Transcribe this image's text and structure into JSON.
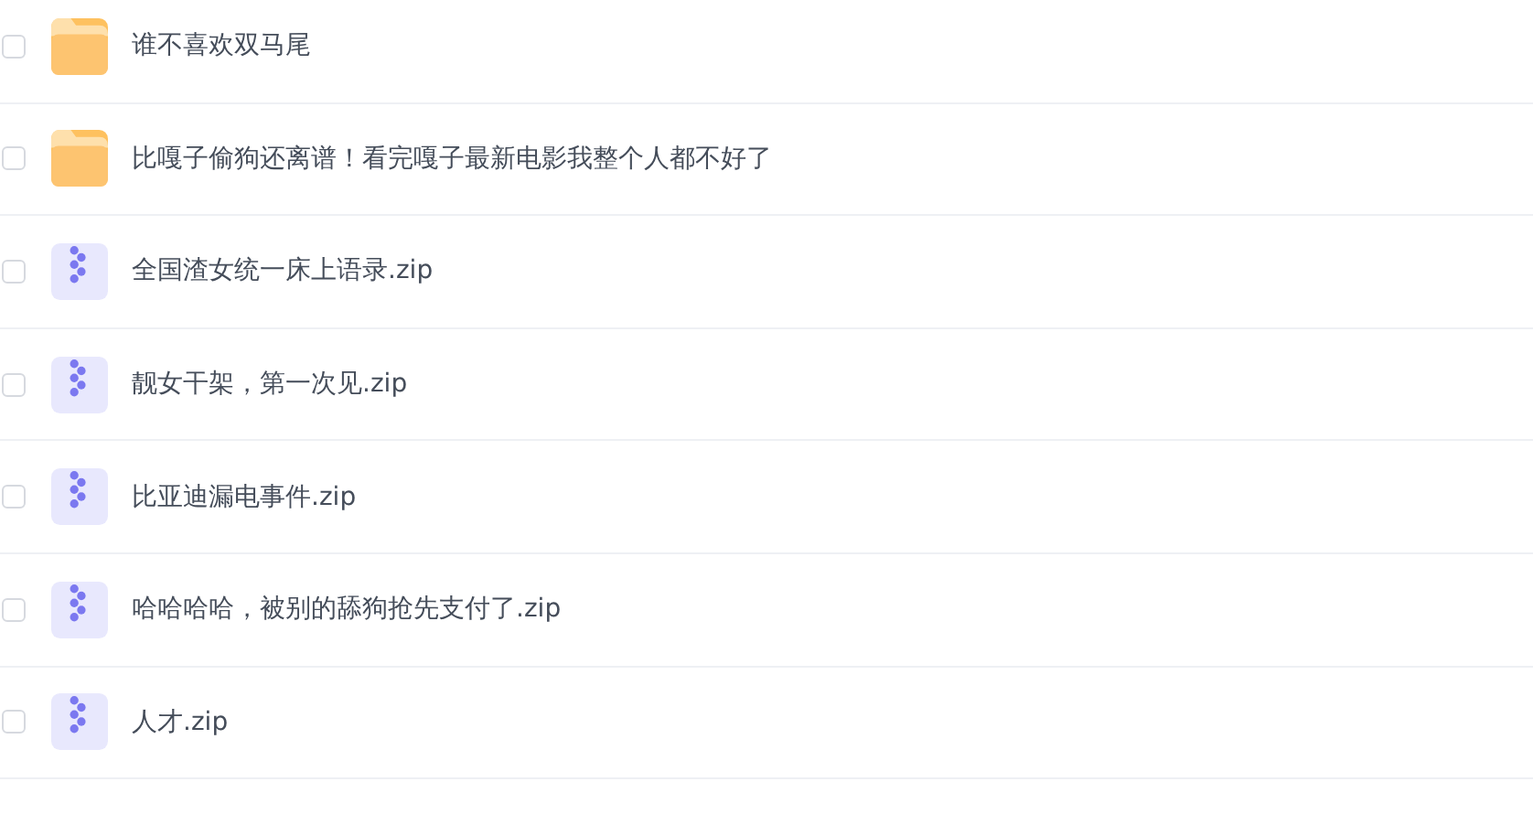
{
  "files": [
    {
      "kind": "folder",
      "name": "谁不喜欢双马尾",
      "checked": false
    },
    {
      "kind": "folder",
      "name": "比嘎子偷狗还离谱！看完嘎子最新电影我整个人都不好了",
      "checked": false
    },
    {
      "kind": "zip",
      "name": "全国渣女统一床上语录.zip",
      "checked": false
    },
    {
      "kind": "zip",
      "name": "靓女干架，第一次见.zip",
      "checked": false
    },
    {
      "kind": "zip",
      "name": "比亚迪漏电事件.zip",
      "checked": false
    },
    {
      "kind": "zip",
      "name": "哈哈哈哈，被别的舔狗抢先支付了.zip",
      "checked": false
    },
    {
      "kind": "zip",
      "name": "人才.zip",
      "checked": false
    }
  ]
}
